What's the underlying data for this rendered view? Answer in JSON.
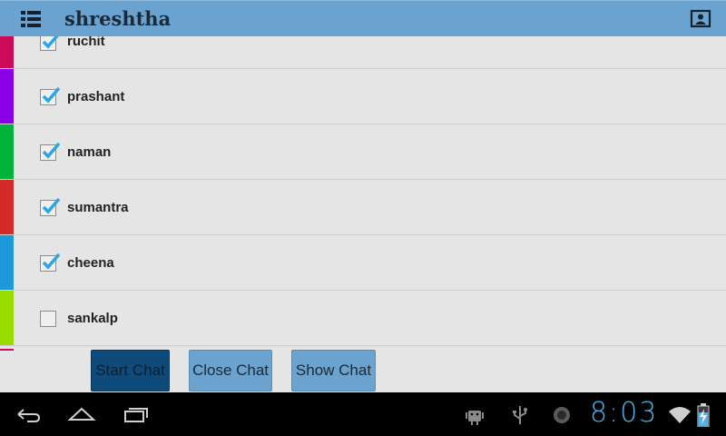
{
  "app": {
    "title": "shreshtha"
  },
  "icons": {
    "menu": "list-menu-icon",
    "profile": "contact-card-icon"
  },
  "contacts": [
    {
      "name": "ruchit",
      "checked": true,
      "color": "#cc0a5a"
    },
    {
      "name": "prashant",
      "checked": true,
      "color": "#8a00e6"
    },
    {
      "name": "naman",
      "checked": true,
      "color": "#00b33c"
    },
    {
      "name": "sumantra",
      "checked": true,
      "color": "#d42a2a"
    },
    {
      "name": "cheena",
      "checked": true,
      "color": "#1c98db"
    },
    {
      "name": "sankalp",
      "checked": false,
      "color": "#99dd00"
    }
  ],
  "buttons": {
    "start_chat": "Start Chat",
    "close_chat": "Close Chat",
    "show_chat": "Show Chat"
  },
  "status_bar": {
    "time": "8:03"
  },
  "colors": {
    "action_bar": "#6aa3cf",
    "accent": "#4fb3e8",
    "check": "#2ba6e0"
  }
}
